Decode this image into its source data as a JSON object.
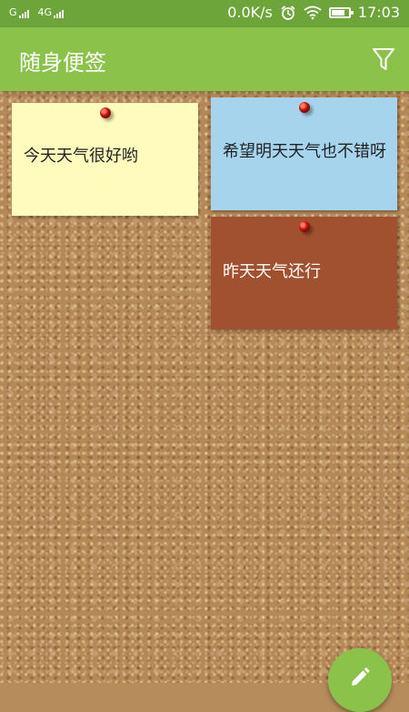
{
  "status_bar": {
    "network_1": "G",
    "network_2": "4G",
    "speed": "0.0K/s",
    "time": "17:03",
    "battery_level": 0.7
  },
  "app_bar": {
    "title": "随身便签",
    "filter_icon": "filter-icon"
  },
  "notes": [
    {
      "text": "今天天气很好哟",
      "color": "#fffbbd"
    },
    {
      "text": "希望明天天气也不错呀",
      "color": "#a6d4ed"
    },
    {
      "text": "昨天天气还行",
      "color": "#a1512f"
    }
  ],
  "fab": {
    "icon": "pencil-icon"
  }
}
